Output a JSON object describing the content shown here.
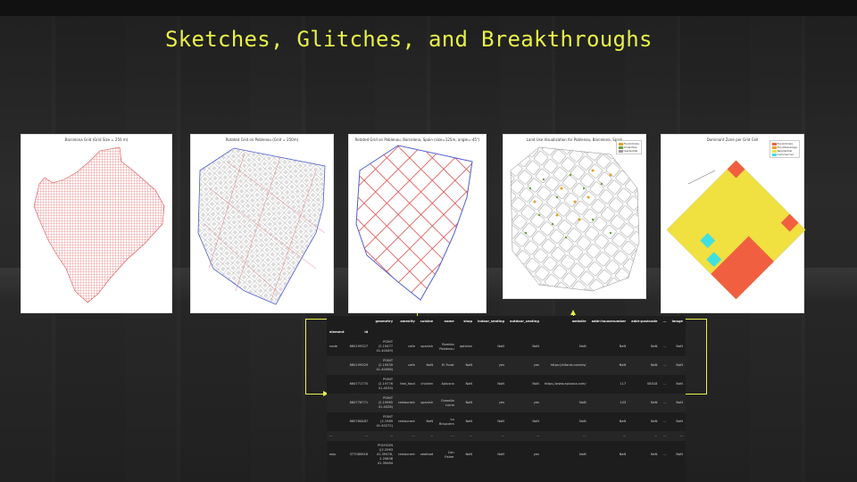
{
  "slide": {
    "title": "Sketches, Glitches, and Breakthroughs"
  },
  "panels": [
    {
      "title": "Barcelona Grid (Grid Size = 250 m)"
    },
    {
      "title": "Rotated Grid on Poblenou (Grid = 250m)"
    },
    {
      "title": "Rotated Grid on Poblenou, Barcelona, Spain (size=125m, angle=-45°)"
    },
    {
      "title": "Land Use Visualization for Poblenou, Barcelona, Spain",
      "legend": [
        "Food/drinks",
        "Amenities",
        "residential"
      ]
    },
    {
      "title": "Dominant Zone per Grid Cell",
      "legend": [
        "Food/drinks",
        "Food/beverage",
        "Residential",
        "Commercial"
      ]
    }
  ],
  "colors": {
    "title": "#e8f04a",
    "connector": "#e8f04a",
    "grid_red": "#e05050",
    "boundary_blue": "#5060d0",
    "zone_yellow": "#f0e040",
    "zone_red": "#f06040",
    "zone_cyan": "#40e0e0"
  },
  "table": {
    "index_header": [
      "element",
      "id"
    ],
    "columns": [
      "geometry",
      "amenity",
      "cuisine",
      "name",
      "shop",
      "indoor_seating",
      "outdoor_seating",
      "website",
      "addr:housenumber",
      "addr:postcode",
      "...",
      "image"
    ],
    "rows": [
      {
        "element": "node",
        "id": "660199327",
        "cells": [
          "POINT (2.19477 41.40449)",
          "cafe",
          "spanish",
          "Rambla Poblenou",
          "optician",
          "NaN",
          "NaN",
          "NaN",
          "NaN",
          "NaN",
          "...",
          "NaN"
        ]
      },
      {
        "element": "",
        "id": "660199329",
        "cells": [
          "POINT (2.19439 41.40498)",
          "cafe",
          "NaN",
          "El Forat",
          "NaN",
          "yes",
          "yes",
          "https://elforat.com/es/",
          "NaN",
          "NaN",
          "...",
          "NaN"
        ]
      },
      {
        "element": "",
        "id": "660771770",
        "cells": [
          "POINT (2.19776 41.4033)",
          "fast_food",
          "chicken",
          "Aplusna",
          "NaN",
          "NaN",
          "NaN",
          "https://www.aplusna.com/",
          "117",
          "08018",
          "...",
          "NaN"
        ]
      },
      {
        "element": "",
        "id": "660776771",
        "cells": [
          "POINT (2.19965 41.4028)",
          "restaurant",
          "spanish",
          "Grosella cuina",
          "NaN",
          "yes",
          "yes",
          "NaN",
          "103",
          "NaN",
          "...",
          "NaN"
        ]
      },
      {
        "element": "",
        "id": "660784487",
        "cells": [
          "POINT (2.1989 41.40272)",
          "restaurant",
          "NaN",
          "La Bruguera",
          "NaN",
          "NaN",
          "NaN",
          "NaN",
          "NaN",
          "NaN",
          "...",
          "NaN"
        ]
      },
      {
        "element": "...",
        "id": "...",
        "cells": [
          "...",
          "...",
          "...",
          "...",
          "...",
          "...",
          "...",
          "...",
          "...",
          "...",
          "...",
          "..."
        ]
      },
      {
        "element": "way",
        "id": "377080616",
        "cells": [
          "POLYGON ((2.2063 41.39478, 2.20638 41.39484",
          "restaurant",
          "seafood",
          "Can Fisher",
          "NaN",
          "NaN",
          "yes",
          "NaN",
          "NaN",
          "NaN",
          "...",
          "NaN"
        ]
      }
    ]
  }
}
